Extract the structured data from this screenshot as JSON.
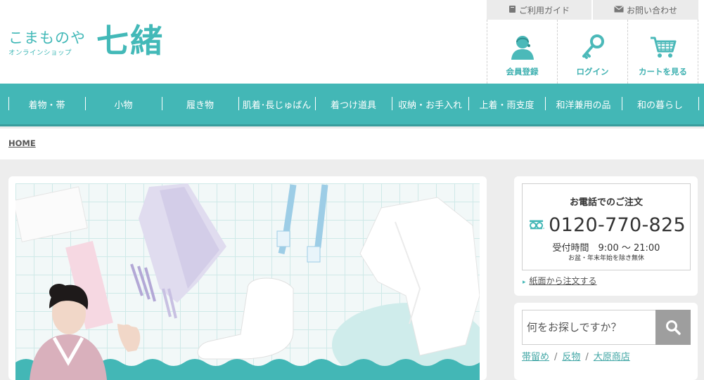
{
  "header": {
    "logo_main": "こまものや",
    "logo_sub": "オンラインショップ",
    "logo_big": "七緒",
    "util_links": [
      {
        "label": "ご利用ガイド",
        "icon": "book-icon"
      },
      {
        "label": "お問い合わせ",
        "icon": "mail-icon"
      }
    ],
    "user_nav": [
      {
        "label": "会員登録",
        "icon": "user-register-icon"
      },
      {
        "label": "ログイン",
        "icon": "key-icon"
      },
      {
        "label": "カートを見る",
        "icon": "cart-icon"
      }
    ]
  },
  "gnav": {
    "items": [
      "着物・帯",
      "小物",
      "履き物",
      "肌着･長じゅばん",
      "着つけ道具",
      "収納・お手入れ",
      "上着・雨支度",
      "和洋兼用の品",
      "和の暮らし"
    ]
  },
  "breadcrumb": {
    "home": "HOME"
  },
  "sidebar": {
    "phone": {
      "title": "お電話でのご注文",
      "number": "0120-770-825",
      "hours": "受付時間　9:00 〜 21:00",
      "note": "お盆・年末年始を除き無休",
      "icon": "freedial-icon"
    },
    "paper_order": "紙面から注文する",
    "search": {
      "placeholder": "何をお探しですか？",
      "keywords": [
        "帯留め",
        "反物",
        "大原商店"
      ]
    }
  },
  "colors": {
    "accent": "#43b7b6",
    "search_button": "#9e9e9e"
  }
}
